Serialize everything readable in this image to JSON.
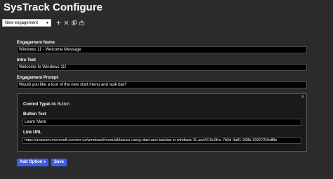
{
  "app": {
    "title": "SysTrack Configure"
  },
  "selector": {
    "value": "New engagement"
  },
  "toolbar": {
    "icons": [
      "plus-icon",
      "close-icon",
      "copy-icon",
      "export-icon"
    ]
  },
  "form": {
    "engagement_name": {
      "label": "Engagement Name",
      "value": "Windows 11 - Welcome Message"
    },
    "intro_text": {
      "label": "Intro Text",
      "value": "Welcome to Windows 11!"
    },
    "engagement_prompt": {
      "label": "Engagement Prompt",
      "value": "Would you like a tour of the new start menu and task bar?"
    }
  },
  "option_panel": {
    "close_glyph": "×",
    "control_type_label": "Control Type:",
    "control_type_value": "Link Button",
    "button_text_label": "Button Text",
    "button_text_value": "Learn More",
    "link_url_label": "Link URL",
    "link_url_value": "https://answers.microsoft.com/en-us/windows/forum/all/basics-using-start-and-taskbar-in-windows-11-and/415c0fce-7b5d-4a81-968b-3900720bdf8e"
  },
  "actions": {
    "add_option_label": "Add Option",
    "add_option_caret": "▾",
    "save_label": "Save"
  },
  "colors": {
    "background": "#2b2b2b",
    "panel": "#1a1a1a",
    "accent": "#3d5ff0",
    "field_bg": "#000000"
  }
}
